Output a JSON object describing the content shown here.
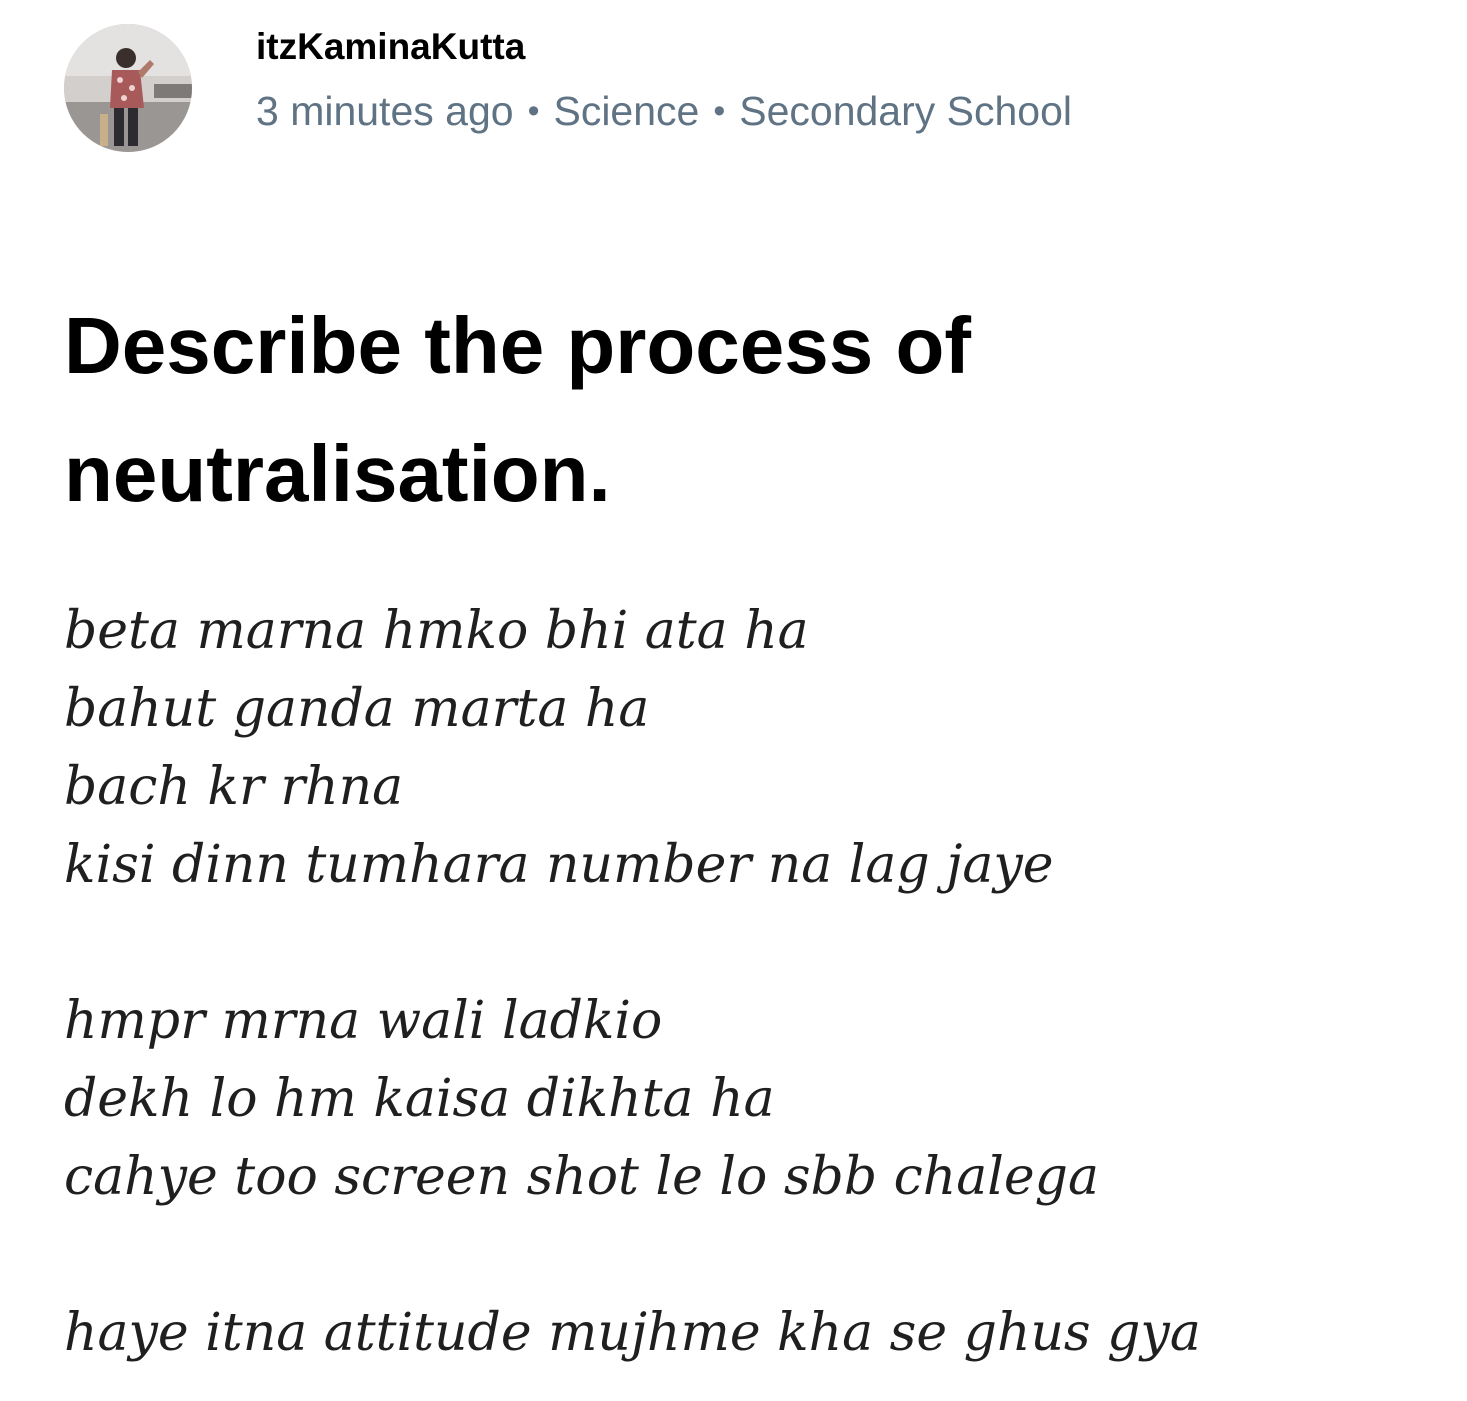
{
  "author": {
    "username": "itzKaminaKutta",
    "avatar_icon": "user-avatar-photo"
  },
  "meta": {
    "time_ago": "3 minutes ago",
    "separator": "•",
    "subject": "Science",
    "level": "Secondary School"
  },
  "question": {
    "title": "Describe the process of neutralisation.",
    "stanzas": [
      {
        "lines": [
          "beta marna hmko bhi ata ha",
          "bahut ganda marta ha",
          "bach kr rhna",
          "kisi dinn tumhara number na lag jaye"
        ]
      },
      {
        "lines": [
          "hmpr mrna wali ladkio",
          "dekh lo hm kaisa dikhta ha",
          "cahye too screen shot le lo sbb chalega"
        ]
      },
      {
        "lines": [
          "haye itna attitude mujhme kha se ghus gya"
        ]
      }
    ]
  },
  "colors": {
    "meta_text": "#5f7384",
    "title_text": "#000000",
    "body_text": "#1f1f1f"
  }
}
